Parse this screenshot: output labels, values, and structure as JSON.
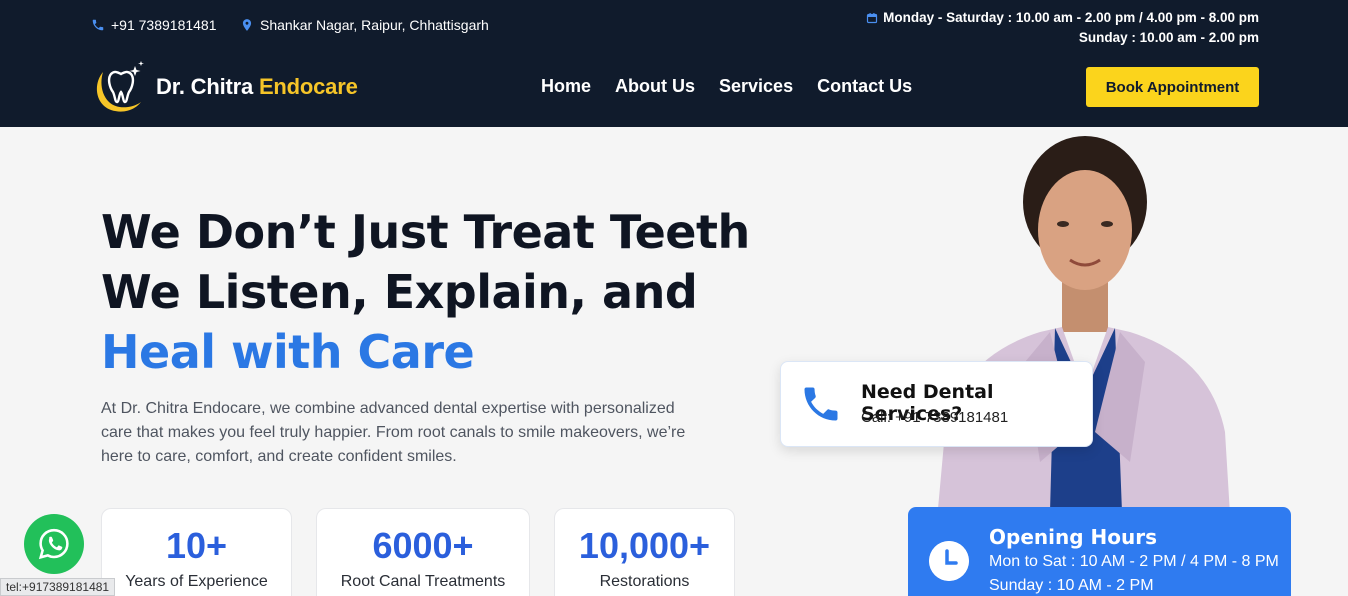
{
  "topbar": {
    "phone": "+91 7389181481",
    "address": "Shankar Nagar, Raipur, Chhattisgarh",
    "hours_weekdays": "Monday - Saturday : 10.00 am - 2.00 pm / 4.00 pm - 8.00 pm",
    "hours_sunday": "Sunday : 10.00 am - 2.00 pm"
  },
  "brand": {
    "name_part1": "Dr. Chitra",
    "name_part2": "Endocare"
  },
  "nav": {
    "home": "Home",
    "about": "About Us",
    "services": "Services",
    "contact": "Contact Us"
  },
  "cta": {
    "book": "Book Appointment"
  },
  "hero": {
    "line1": "We Don’t Just Treat Teeth",
    "line2": "We Listen, Explain, and",
    "line3": "Heal with Care",
    "description": "At Dr. Chitra Endocare, we combine advanced dental expertise with personalized care that makes you feel truly happier. From root canals to smile makeovers, we’re here to care, comfort, and create confident smiles."
  },
  "stats": [
    {
      "value": "10+",
      "label": "Years of Experience"
    },
    {
      "value": "6000+",
      "label": "Root Canal Treatments"
    },
    {
      "value": "10,000+",
      "label": "Restorations"
    }
  ],
  "need_card": {
    "title": "Need Dental Services?",
    "call": "Call: +91 7389181481"
  },
  "opening": {
    "title": "Opening Hours",
    "line1": "Mon to Sat : 10 AM - 2 PM / 4 PM - 8 PM",
    "line2": "Sunday : 10 AM - 2 PM"
  },
  "statusbar": {
    "link": "tel:+917389181481"
  },
  "colors": {
    "header_bg": "#101b2c",
    "accent_yellow": "#fbd41c",
    "brand_blue": "#2b78e4",
    "whatsapp_green": "#22c05a"
  }
}
